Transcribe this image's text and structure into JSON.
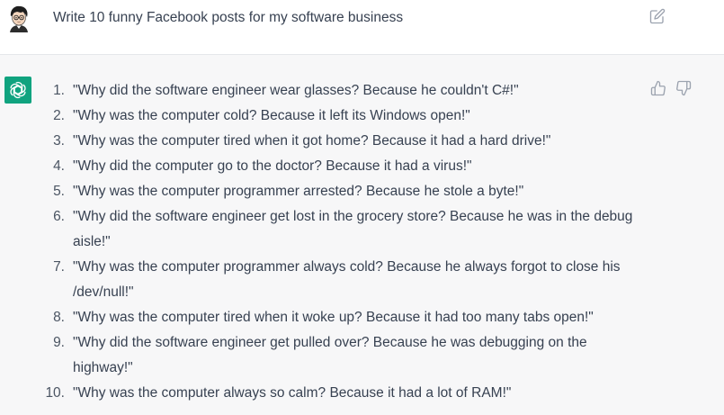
{
  "user_message": {
    "text": "Write 10 funny Facebook posts for my software business"
  },
  "assistant_message": {
    "items": [
      {
        "num": "1.",
        "text": "\"Why did the software engineer wear glasses? Because he couldn't C#!\""
      },
      {
        "num": "2.",
        "text": "\"Why was the computer cold? Because it left its Windows open!\""
      },
      {
        "num": "3.",
        "text": "\"Why was the computer tired when it got home? Because it had a hard drive!\""
      },
      {
        "num": "4.",
        "text": "\"Why did the computer go to the doctor? Because it had a virus!\""
      },
      {
        "num": "5.",
        "text": "\"Why was the computer programmer arrested? Because he stole a byte!\""
      },
      {
        "num": "6.",
        "text": "\"Why did the software engineer get lost in the grocery store? Because he was in the debug aisle!\""
      },
      {
        "num": "7.",
        "text": "\"Why was the computer programmer always cold? Because he always forgot to close his /dev/null!\""
      },
      {
        "num": "8.",
        "text": "\"Why was the computer tired when it woke up? Because it had too many tabs open!\""
      },
      {
        "num": "9.",
        "text": "\"Why did the software engineer get pulled over? Because he was debugging on the highway!\""
      },
      {
        "num": "10.",
        "text": "\"Why was the computer always so calm? Because it had a lot of RAM!\""
      }
    ]
  },
  "icons": {
    "user": "user-avatar-icon",
    "edit": "edit-icon",
    "assistant": "openai-logo-icon",
    "thumbs_up": "thumbs-up-icon",
    "thumbs_down": "thumbs-down-icon"
  },
  "colors": {
    "brand": "#10a37f",
    "assistant_bg": "#f7f7f8",
    "text": "#374151"
  }
}
